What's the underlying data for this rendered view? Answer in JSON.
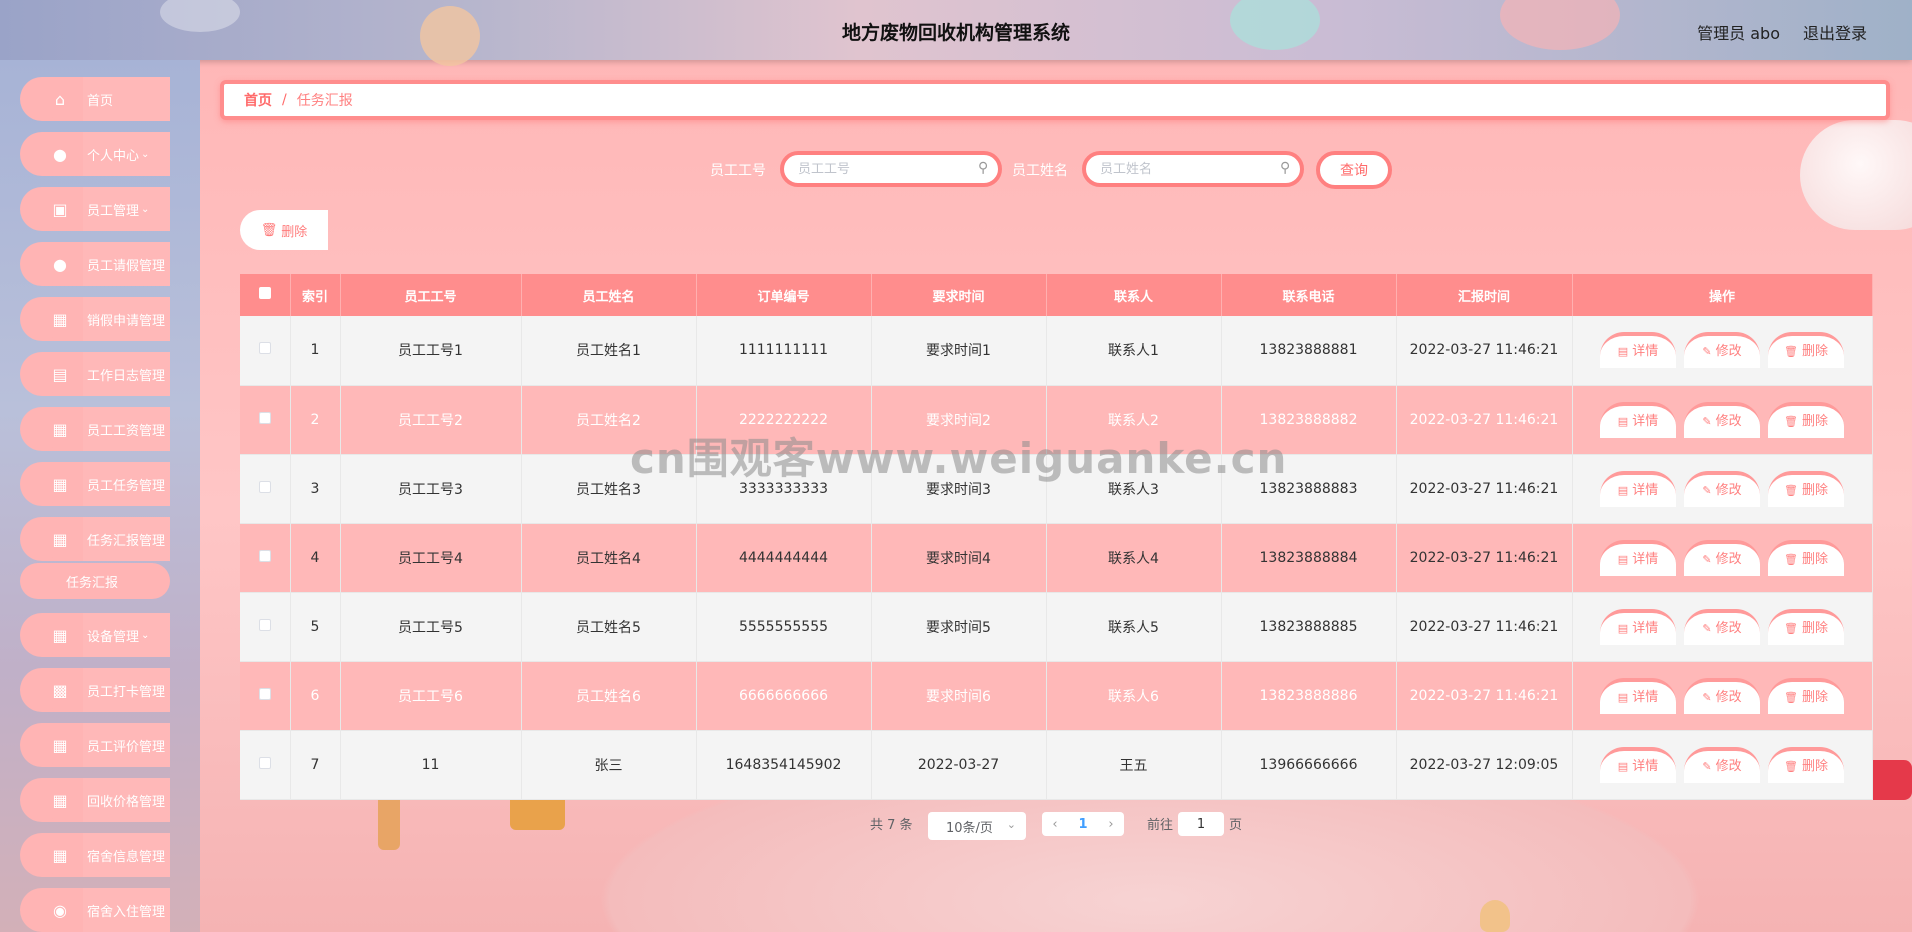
{
  "header": {
    "title": "地方废物回收机构管理系统",
    "user": "管理员 abo",
    "logout": "退出登录"
  },
  "sidebar": {
    "items": [
      {
        "label": "首页",
        "icon": "home-icon",
        "chevron": false
      },
      {
        "label": "个人中心",
        "icon": "user-icon",
        "chevron": true
      },
      {
        "label": "员工管理",
        "icon": "briefcase-icon",
        "chevron": true
      },
      {
        "label": "员工请假管理",
        "icon": "user-icon",
        "chevron": false
      },
      {
        "label": "销假申请管理",
        "icon": "grid-icon",
        "chevron": false
      },
      {
        "label": "工作日志管理",
        "icon": "clipboard-icon",
        "chevron": false
      },
      {
        "label": "员工工资管理",
        "icon": "grid-icon",
        "chevron": false
      },
      {
        "label": "员工任务管理",
        "icon": "grid-icon",
        "chevron": false
      },
      {
        "label": "任务汇报管理",
        "icon": "grid-icon",
        "chevron": false
      },
      {
        "label": "设备管理",
        "icon": "grid-icon",
        "chevron": true
      },
      {
        "label": "员工打卡管理",
        "icon": "chart-icon",
        "chevron": false
      },
      {
        "label": "员工评价管理",
        "icon": "table-icon",
        "chevron": false
      },
      {
        "label": "回收价格管理",
        "icon": "grid-icon",
        "chevron": false
      },
      {
        "label": "宿舍信息管理",
        "icon": "grid-icon",
        "chevron": false
      },
      {
        "label": "宿舍入住管理",
        "icon": "location-icon",
        "chevron": false
      }
    ],
    "sub_item": "任务汇报"
  },
  "breadcrumb": {
    "home": "首页",
    "separator": "/",
    "current": "任务汇报"
  },
  "search": {
    "field1_label": "员工工号",
    "field1_placeholder": "员工工号",
    "field2_label": "员工姓名",
    "field2_placeholder": "员工姓名",
    "query_button": "查询"
  },
  "toolbar": {
    "delete_button": "删除"
  },
  "table": {
    "headers": [
      "",
      "索引",
      "员工工号",
      "员工姓名",
      "订单编号",
      "要求时间",
      "联系人",
      "联系电话",
      "汇报时间",
      "操作"
    ],
    "rows": [
      {
        "index": "1",
        "emp_no": "员工工号1",
        "emp_name": "员工姓名1",
        "order_no": "1111111111",
        "req_time": "要求时间1",
        "contact": "联系人1",
        "phone": "13823888881",
        "report_time": "2022-03-27 11:46:21"
      },
      {
        "index": "2",
        "emp_no": "员工工号2",
        "emp_name": "员工姓名2",
        "order_no": "2222222222",
        "req_time": "要求时间2",
        "contact": "联系人2",
        "phone": "13823888882",
        "report_time": "2022-03-27 11:46:21"
      },
      {
        "index": "3",
        "emp_no": "员工工号3",
        "emp_name": "员工姓名3",
        "order_no": "3333333333",
        "req_time": "要求时间3",
        "contact": "联系人3",
        "phone": "13823888883",
        "report_time": "2022-03-27 11:46:21"
      },
      {
        "index": "4",
        "emp_no": "员工工号4",
        "emp_name": "员工姓名4",
        "order_no": "4444444444",
        "req_time": "要求时间4",
        "contact": "联系人4",
        "phone": "13823888884",
        "report_time": "2022-03-27 11:46:21"
      },
      {
        "index": "5",
        "emp_no": "员工工号5",
        "emp_name": "员工姓名5",
        "order_no": "5555555555",
        "req_time": "要求时间5",
        "contact": "联系人5",
        "phone": "13823888885",
        "report_time": "2022-03-27 11:46:21"
      },
      {
        "index": "6",
        "emp_no": "员工工号6",
        "emp_name": "员工姓名6",
        "order_no": "6666666666",
        "req_time": "要求时间6",
        "contact": "联系人6",
        "phone": "13823888886",
        "report_time": "2022-03-27 11:46:21"
      },
      {
        "index": "7",
        "emp_no": "11",
        "emp_name": "张三",
        "order_no": "1648354145902",
        "req_time": "2022-03-27",
        "contact": "王五",
        "phone": "13966666666",
        "report_time": "2022-03-27 12:09:05"
      }
    ],
    "actions": {
      "detail": "详情",
      "edit": "修改",
      "delete": "删除"
    }
  },
  "pagination": {
    "total": "共 7 条",
    "page_size": "10条/页",
    "current_page": "1",
    "goto_label": "前往",
    "goto_value": "1",
    "page_unit": "页"
  },
  "watermark": "cn围观客www.weiguanke.cn",
  "colors": {
    "accent": "#ff8d8d",
    "row_alt": "#ffb8b8",
    "row_base": "#f4f4f4"
  }
}
